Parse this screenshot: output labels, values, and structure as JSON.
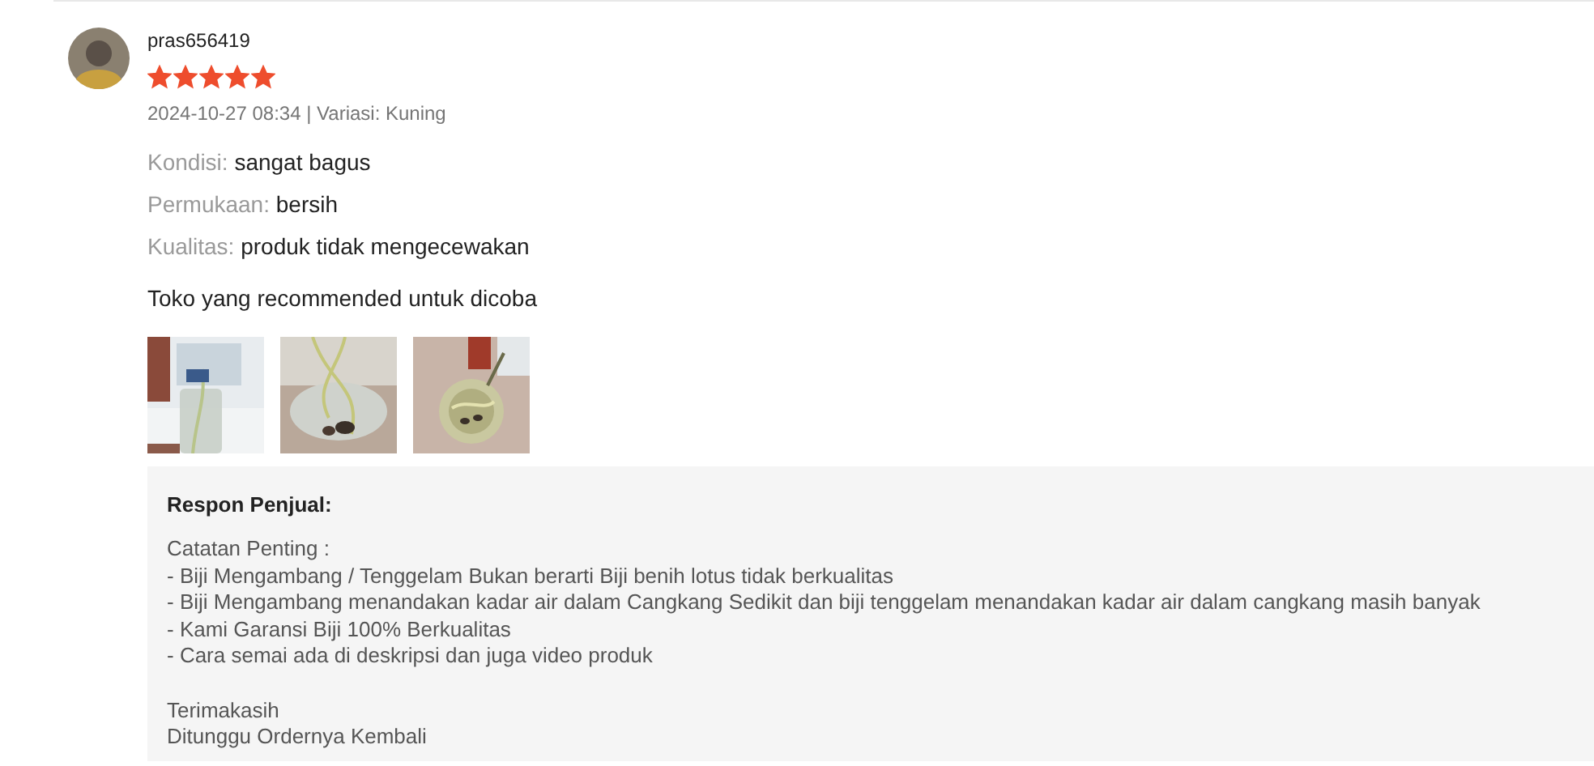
{
  "review": {
    "username": "pras656419",
    "stars": 5,
    "meta": "2024-10-27 08:34 | Variasi: Kuning",
    "attributes": [
      {
        "label": "Kondisi:",
        "value": "sangat bagus"
      },
      {
        "label": "Permukaan:",
        "value": "bersih"
      },
      {
        "label": "Kualitas:",
        "value": "produk tidak mengecewakan"
      }
    ],
    "comment": "Toko yang recommended untuk dicoba",
    "photos": [
      {
        "kind": "picture"
      },
      {
        "kind": "picture"
      },
      {
        "kind": "picture"
      }
    ],
    "seller_response": {
      "title": "Respon Penjual:",
      "lines": [
        "Catatan Penting :",
        "- Biji Mengambang / Tenggelam Bukan berarti Biji benih lotus tidak berkualitas",
        "- Biji Mengambang menandakan kadar air dalam Cangkang Sedikit dan biji tenggelam menandakan kadar air dalam cangkang masih banyak",
        "- Kami Garansi Biji 100% Berkualitas",
        "- Cara semai ada di deskripsi dan juga video produk"
      ],
      "closing": [
        "Terimakasih",
        "Ditunggu Ordernya Kembali"
      ]
    }
  }
}
